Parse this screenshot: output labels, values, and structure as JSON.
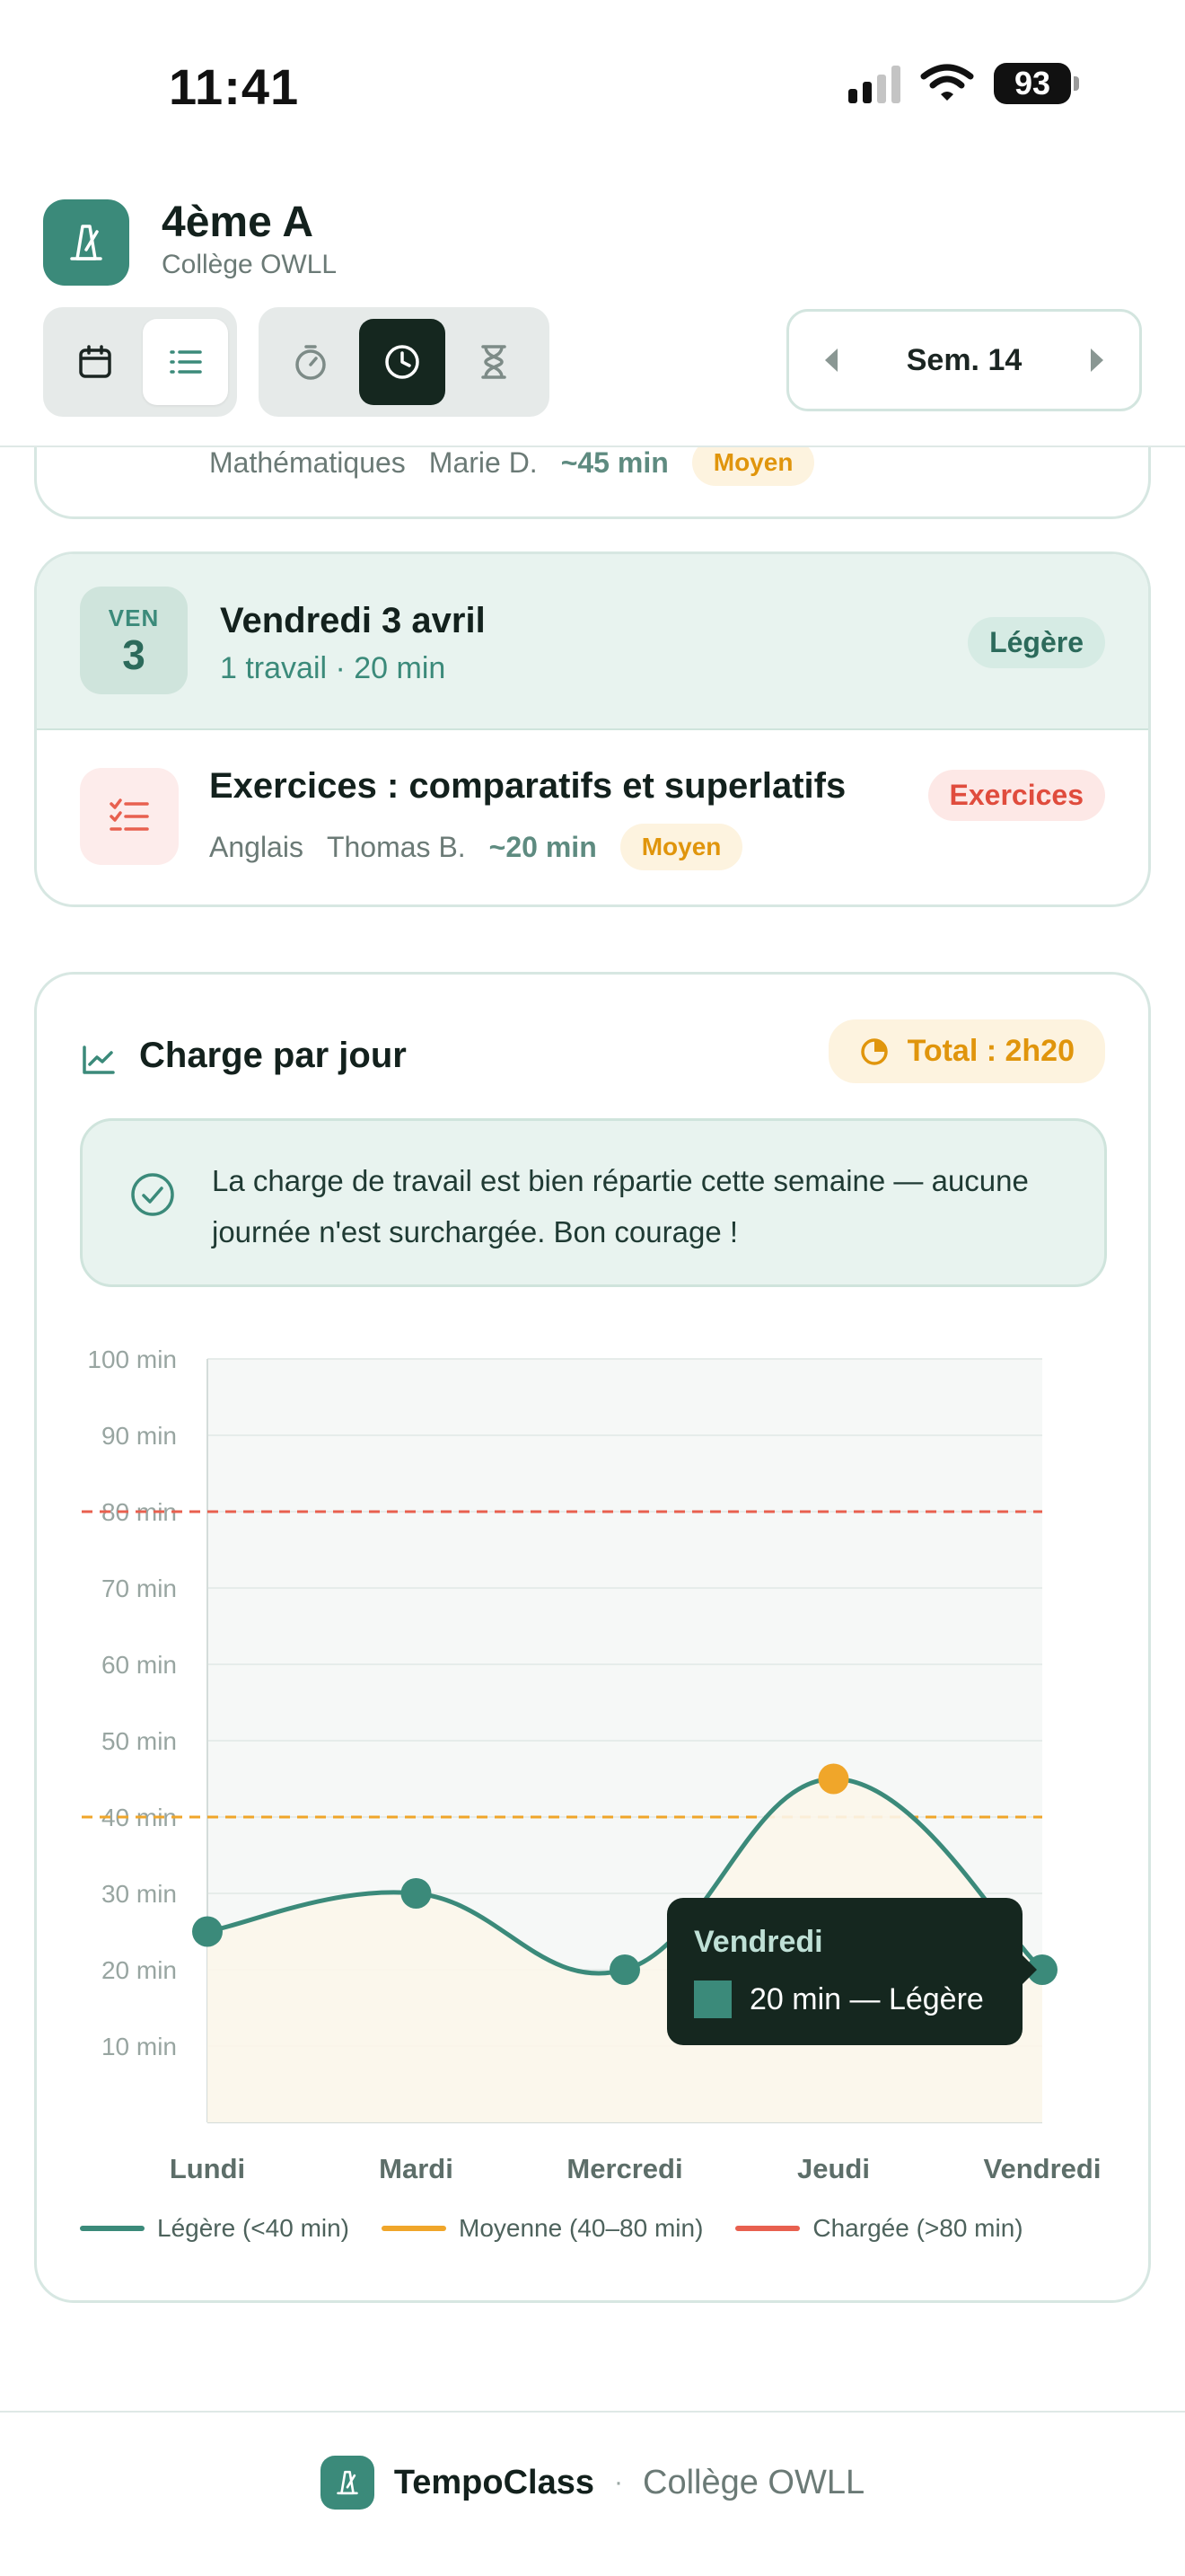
{
  "status_bar": {
    "time": "11:41",
    "battery": "93"
  },
  "header": {
    "class_name": "4ème A",
    "school": "Collège OWLL",
    "week_label": "Sem. 14",
    "views": [
      "calendar-icon",
      "list-icon"
    ],
    "modes": [
      "timer-icon",
      "clock-icon",
      "hourglass-icon"
    ],
    "active_view": "list",
    "active_mode": "clock"
  },
  "previous_card": {
    "subject": "Mathématiques",
    "teacher": "Marie D.",
    "duration": "~45 min",
    "level": "Moyen"
  },
  "day_card": {
    "day_abbr": "VEN",
    "day_num": "3",
    "title": "Vendredi 3 avril",
    "summary": "1 travail · 20 min",
    "load": "Légère",
    "task": {
      "title": "Exercices : comparatifs et superlatifs",
      "subject": "Anglais",
      "teacher": "Thomas B.",
      "duration": "~20 min",
      "level": "Moyen",
      "type": "Exercices"
    }
  },
  "chart_card": {
    "title": "Charge par jour",
    "total": "Total : 2h20",
    "message": "La charge de travail est bien répartie cette semaine — aucune journée n'est surchargée. Bon courage !",
    "tooltip": {
      "title": "Vendredi",
      "value": "20 min — Légère"
    },
    "legend": [
      {
        "label": "Légère (<40 min)",
        "color": "#3b8a7a"
      },
      {
        "label": "Moyenne (40–80 min)",
        "color": "#f0a62a"
      },
      {
        "label": "Chargée (>80 min)",
        "color": "#e8604f"
      }
    ]
  },
  "chart_data": {
    "type": "line",
    "categories": [
      "Lundi",
      "Mardi",
      "Mercredi",
      "Jeudi",
      "Vendredi"
    ],
    "series": [
      {
        "values": [
          25,
          30,
          20,
          45,
          20
        ]
      }
    ],
    "point_colors": [
      "#3b8a7a",
      "#3b8a7a",
      "#3b8a7a",
      "#f0a62a",
      "#3b8a7a"
    ],
    "yticks": [
      "100 min",
      "90 min",
      "80 min",
      "70 min",
      "60 min",
      "50 min",
      "40 min",
      "30 min",
      "20 min",
      "10 min"
    ],
    "ylim": [
      0,
      100
    ],
    "thresholds": [
      {
        "value": 80,
        "color": "#e8604f"
      },
      {
        "value": 40,
        "color": "#f0a62a"
      }
    ],
    "grid": true
  },
  "footer": {
    "app_name": "TempoClass",
    "separator": "·",
    "school": "Collège OWLL"
  }
}
